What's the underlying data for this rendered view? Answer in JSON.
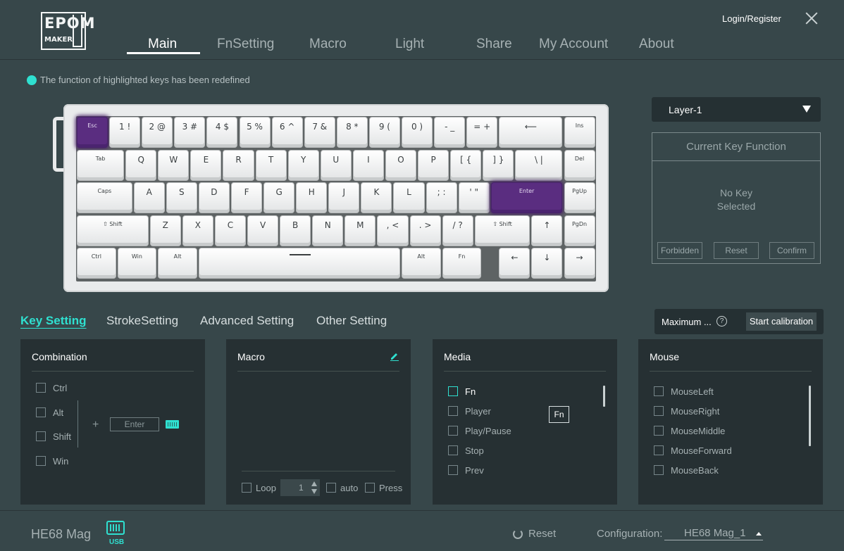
{
  "logo": {
    "line1": "EPOM",
    "line2": "MAKER"
  },
  "nav": {
    "tabs": [
      "Main",
      "FnSetting",
      "Macro",
      "Light",
      "Share",
      "My Account",
      "About"
    ],
    "active": "Main"
  },
  "header": {
    "login_label": "Login/Register"
  },
  "hint": {
    "text": "The function of highlighted keys has been redefined"
  },
  "keyboard": {
    "rows": [
      [
        "Esc",
        "1 !",
        "2 @",
        "3 #",
        "4 $",
        "5 %",
        "6 ^",
        "7 &",
        "8 *",
        "9 (",
        "0 )",
        "- _",
        "= +",
        "⟵",
        "Ins"
      ],
      [
        "Tab",
        "Q",
        "W",
        "E",
        "R",
        "T",
        "Y",
        "U",
        "I",
        "O",
        "P",
        "[ {",
        "] }",
        "\\ |",
        "Del"
      ],
      [
        "Caps",
        "A",
        "S",
        "D",
        "F",
        "G",
        "H",
        "J",
        "K",
        "L",
        "; :",
        "' \"",
        "Enter",
        "PgUp"
      ],
      [
        "⇧ Shift",
        "Z",
        "X",
        "C",
        "V",
        "B",
        "N",
        "M",
        ", <",
        ". >",
        "/ ?",
        "⇧ Shift",
        "↑",
        "PgDn"
      ],
      [
        "Ctrl",
        "Win",
        "Alt",
        "",
        "Alt",
        "Fn",
        "←",
        "↓",
        "→"
      ]
    ],
    "highlighted": [
      "Esc",
      "Enter"
    ]
  },
  "layer": {
    "selected": "Layer-1"
  },
  "current_key_function": {
    "title": "Current Key Function",
    "no_key_line1": "No Key",
    "no_key_line2": "Selected",
    "buttons": [
      "Forbidden",
      "Reset",
      "Confirm"
    ]
  },
  "subtabs": {
    "items": [
      "Key Setting",
      "StrokeSetting",
      "Advanced Setting",
      "Other Setting"
    ],
    "active": "Key Setting"
  },
  "calibration": {
    "label": "Maximum ...",
    "help": "?",
    "button": "Start calibration"
  },
  "combination": {
    "title": "Combination",
    "modifiers": [
      "Ctrl",
      "Alt",
      "Shift",
      "Win"
    ],
    "plus": "+",
    "key_placeholder": "Enter"
  },
  "macro": {
    "title": "Macro",
    "loop_label": "Loop",
    "loop_value": "1",
    "auto_label": "auto",
    "press_label": "Press"
  },
  "media": {
    "title": "Media",
    "items": [
      "Fn",
      "Player",
      "Play/Pause",
      "Stop",
      "Prev"
    ],
    "tooltip": "Fn"
  },
  "mouse": {
    "title": "Mouse",
    "items": [
      "MouseLeft",
      "MouseRight",
      "MouseMiddle",
      "MouseForward",
      "MouseBack"
    ]
  },
  "footer": {
    "device_name": "HE68 Mag",
    "connection": "USB",
    "reset_label": "Reset",
    "config_label": "Configuration:",
    "config_value": "HE68 Mag_1"
  },
  "colors": {
    "accent": "#2fe0d0",
    "background": "#37474a",
    "panel": "#263033",
    "highlight_key": "#5a2d80"
  }
}
